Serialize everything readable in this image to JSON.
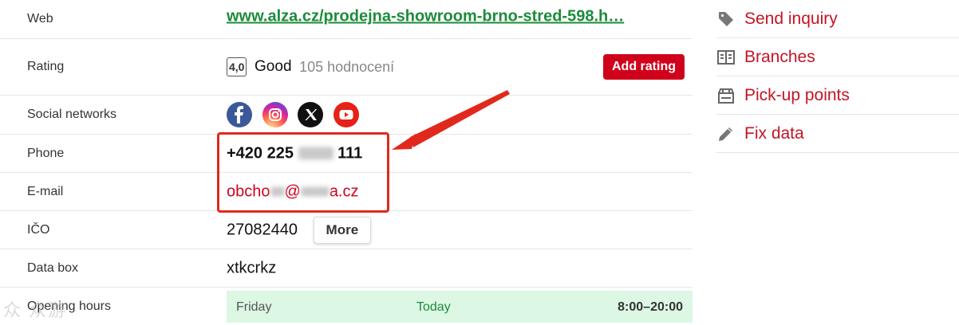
{
  "details": {
    "web": {
      "label": "Web",
      "value": "www.alza.cz/prodejna-showroom-brno-stred-598.h…"
    },
    "rating": {
      "label": "Rating",
      "score": "4,0",
      "word": "Good",
      "count": "105 hodnocení",
      "button": "Add rating"
    },
    "social": {
      "label": "Social networks",
      "icons": [
        "facebook-icon",
        "instagram-icon",
        "x-icon",
        "youtube-icon"
      ]
    },
    "phone": {
      "label": "Phone",
      "prefix": "+420 225",
      "suffix": "111"
    },
    "email": {
      "label": "E-mail",
      "prefix": "obcho",
      "mid": "@",
      "suffix": "a.cz"
    },
    "ico": {
      "label": "IČO",
      "value": "27082440",
      "button": "More"
    },
    "databox": {
      "label": "Data box",
      "value": "xtkcrkz"
    },
    "hours": {
      "label": "Opening hours",
      "day": "Friday",
      "today": "Today",
      "time": "8:00–20:00"
    }
  },
  "actions": [
    {
      "label": "Send inquiry",
      "icon": "tag-icon"
    },
    {
      "label": "Branches",
      "icon": "branches-icon"
    },
    {
      "label": "Pick-up points",
      "icon": "pickup-point-icon"
    },
    {
      "label": "Fix data",
      "icon": "pencil-icon"
    }
  ],
  "annotation": {
    "color": "#e0291c"
  },
  "colors": {
    "accent_red": "#d0021b",
    "link_green": "#1c8b3a",
    "hours_bg": "#dcf7e4"
  },
  "watermark": "众 众游"
}
